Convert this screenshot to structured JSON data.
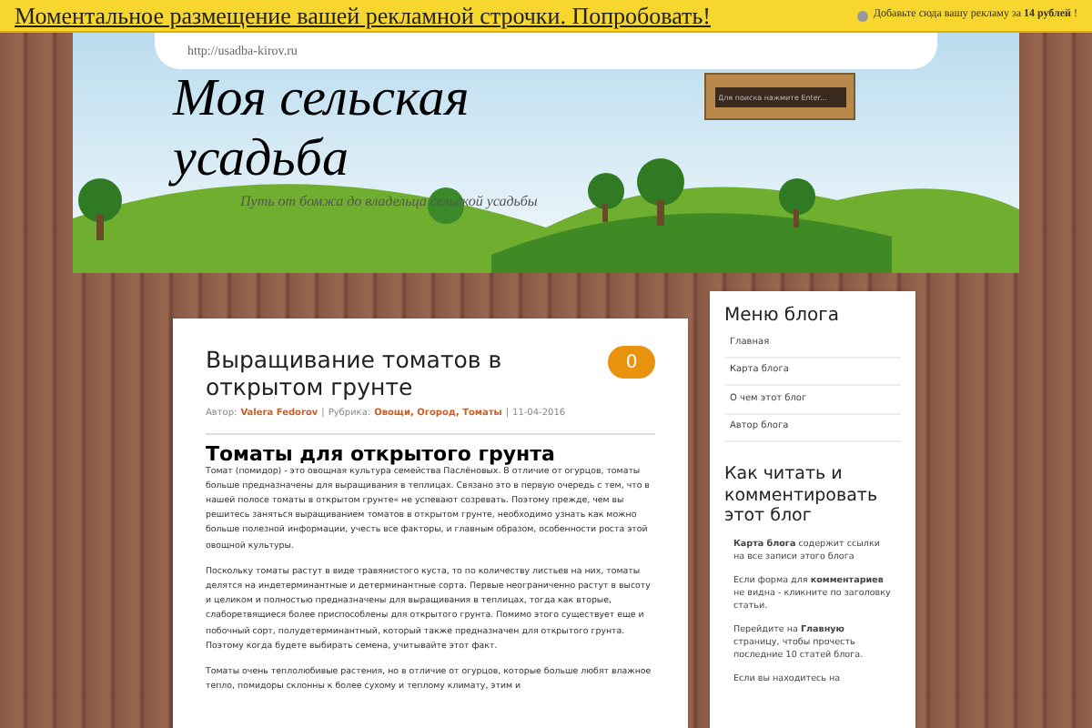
{
  "ad_bar": {
    "link": "Моментальное размещение вашей рекламной строчки. Попробовать!",
    "offer": "Добавьте сюда вашу рекламу за **14 рублей** !"
  },
  "header": {
    "url": "http://usadba-kirov.ru",
    "title": "Моя сельская усадьба",
    "tagline": "Путь от бомжа до владельца сельской усадьбы",
    "search": {
      "placeholder": "Для поиска нажмите Enter..."
    }
  },
  "post": {
    "title": "Выращивание томатов в открытом грунте",
    "comment_count": "0",
    "meta": {
      "separator": "|",
      "author_label": "Автор:",
      "author": "Valera Fedorov",
      "category_label": "Рубрика:",
      "categories": "Овощи, Огород, Томаты",
      "date": "11-04-2016"
    },
    "heading": "Томаты для открытого грунта",
    "paragraphs": [
      "Томат (помидор) - это овощная культура семейства Паслёновых. В отличие от огурцов, томаты больше предназначены для выращивания в теплицах. Связано это в первую очередь с тем, что в нашей полосе томаты в открытом грунте« не успевают созревать. Поэтому прежде, чем вы решитесь заняться выращиванием томатов в открытом грунте, необходимо узнать как можно больше полезной информации, учесть все факторы, и главным образом, особенности роста этой овощной культуры.",
      "Поскольку томаты растут в виде травянистого куста, то по количеству листьев на них, томаты делятся на индетерминантные и детерминантные сорта. Первые неограниченно растут в высоту и целиком и полностью предназначены для выращивания в теплицах, тогда как вторые, слаборетвящиеся более приспособлены для открытого грунта. Помимо этого существует еще и побочный сорт, полудетерминантный, который также предназначен для открытого грунта. Поэтому когда будете выбирать семена, учитывайте этот факт.",
      "Томаты очень теплолюбивые растения, но в отличие от огурцов, которые больше любят влажное тепло, помидоры склонны к более сухому и теплому климату, этим и"
    ]
  },
  "sidebar": {
    "menu_title": "Меню блога",
    "menu_items": [
      "Главная",
      "Карта блога",
      "О чем этот блог",
      "Автор блога"
    ],
    "help_title": "Как читать и комментировать этот блог",
    "help_paragraphs": [
      "**Карта блога** содержит ссылки на все записи этого блога",
      "Если форма для **комментариев** не видна - кликните по заголовку статьи.",
      "Перейдите на **Главную** страницу, чтобы прочесть последние 10 статей блога.",
      "Если вы находитесь на"
    ]
  }
}
